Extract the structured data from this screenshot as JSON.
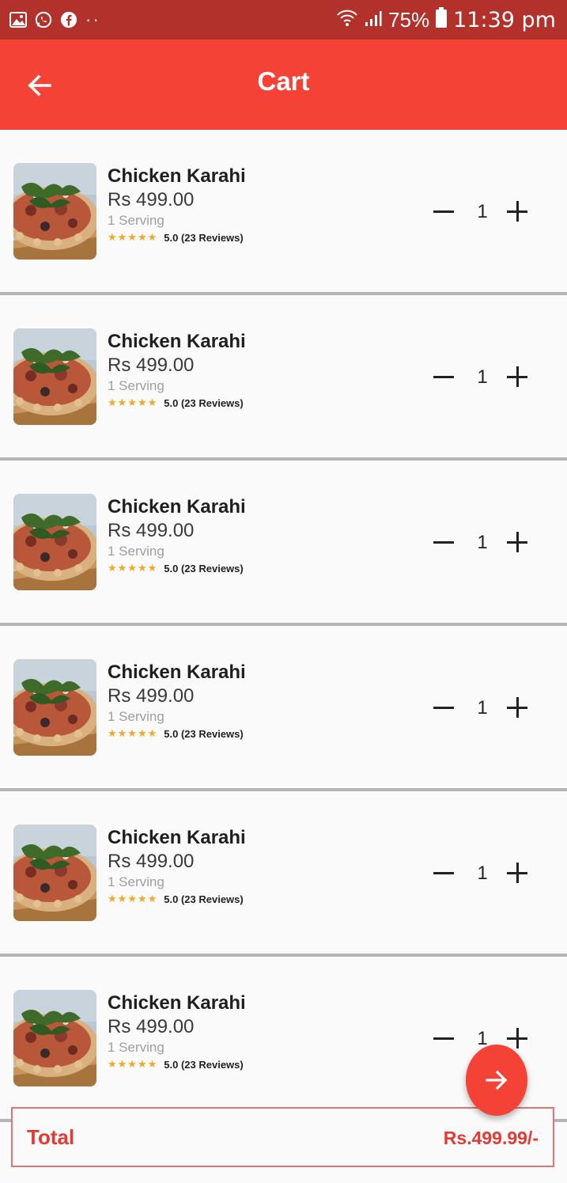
{
  "status_bar": {
    "left_icons": [
      "gallery-icon",
      "whatsapp-icon",
      "facebook-icon"
    ],
    "dots": "··",
    "battery": "75%",
    "time": "11:39 pm"
  },
  "app_bar": {
    "title": "Cart"
  },
  "items": [
    {
      "name": "Chicken Karahi",
      "price": "Rs 499.00",
      "serving": "1 Serving",
      "stars": "★★★★★",
      "rating": "5.0 (23 Reviews)",
      "quantity": "1"
    },
    {
      "name": "Chicken Karahi",
      "price": "Rs 499.00",
      "serving": "1 Serving",
      "stars": "★★★★★",
      "rating": "5.0 (23 Reviews)",
      "quantity": "1"
    },
    {
      "name": "Chicken Karahi",
      "price": "Rs 499.00",
      "serving": "1 Serving",
      "stars": "★★★★★",
      "rating": "5.0 (23 Reviews)",
      "quantity": "1"
    },
    {
      "name": "Chicken Karahi",
      "price": "Rs 499.00",
      "serving": "1 Serving",
      "stars": "★★★★★",
      "rating": "5.0 (23 Reviews)",
      "quantity": "1"
    },
    {
      "name": "Chicken Karahi",
      "price": "Rs 499.00",
      "serving": "1 Serving",
      "stars": "★★★★★",
      "rating": "5.0 (23 Reviews)",
      "quantity": "1"
    },
    {
      "name": "Chicken Karahi",
      "price": "Rs 499.00",
      "serving": "1 Serving",
      "stars": "★★★★★",
      "rating": "5.0 (23 Reviews)",
      "quantity": "1"
    }
  ],
  "total": {
    "label": "Total",
    "value": "Rs.499.99/-"
  },
  "colors": {
    "app_bar": "#f44336",
    "status_bar": "#b3312b",
    "accent": "#e53935",
    "star": "#f5a623"
  }
}
